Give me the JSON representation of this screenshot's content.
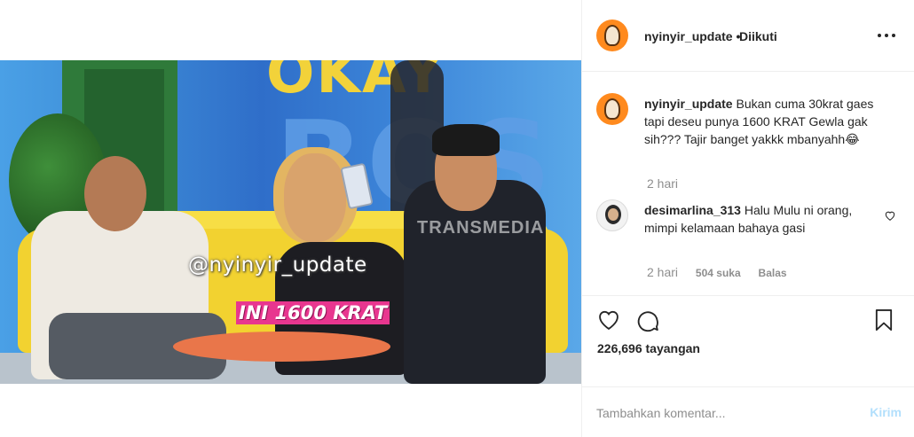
{
  "post": {
    "overlay_watermark": "@nyinyir_update",
    "overlay_caption": "INI 1600 KRAT",
    "scene_sign_top": "OKAY",
    "scene_sign_big": "BOS",
    "scene_channel": "TRANSMEDIA"
  },
  "header": {
    "username": "nyinyir_update",
    "separator": "•",
    "follow_status": "Diikuti",
    "more_icon": "more-horizontal-icon"
  },
  "caption": {
    "username": "nyinyir_update",
    "text": "Bukan cuma 30krat gaes tapi deseu punya 1600 KRAT Gewla gak sih??? Tajir banget yakkk mbanyahh😂",
    "time": "2 hari"
  },
  "comments": [
    {
      "username": "desimarlina_313",
      "text": "Halu Mulu ni orang, mimpi kelamaan bahaya gasi",
      "time": "2 hari",
      "likes": "504 suka",
      "reply_label": "Balas"
    }
  ],
  "actions": {
    "like_icon": "heart-icon",
    "comment_icon": "comment-bubble-icon",
    "save_icon": "bookmark-icon",
    "views_count": "226,696",
    "views_label": "tayangan"
  },
  "add_comment": {
    "placeholder": "Tambahkan komentar...",
    "post_label": "Kirim"
  },
  "colors": {
    "accent_disabled": "#b2dffc",
    "muted_text": "#8e8e8e",
    "border": "#efefef",
    "avatar_orange": "#ff8a1e",
    "overlay_pink": "#e8368f"
  }
}
